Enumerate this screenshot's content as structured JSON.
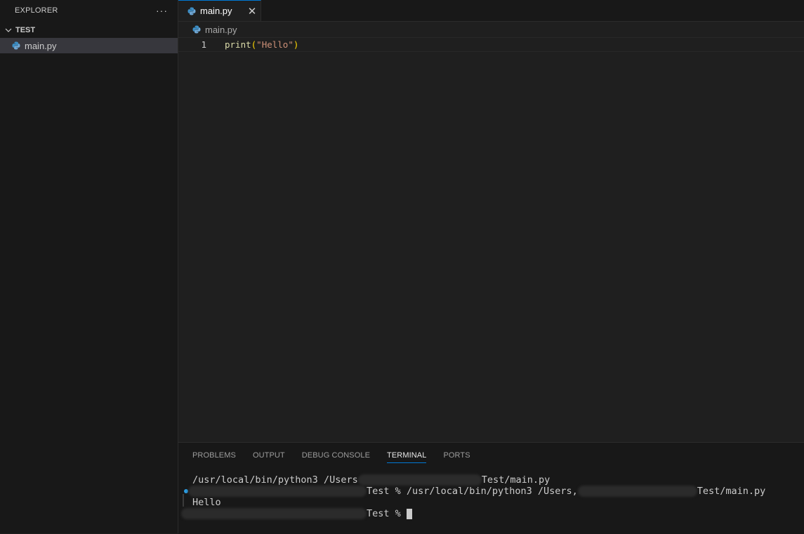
{
  "sidebar": {
    "title": "EXPLORER",
    "more": "···",
    "folder": "TEST",
    "files": [
      {
        "name": "main.py",
        "icon": "python-icon"
      }
    ]
  },
  "editor": {
    "tab": {
      "label": "main.py",
      "close": "✕"
    },
    "breadcrumb": "main.py",
    "lines": [
      {
        "num": "1",
        "fn": "print",
        "open": "(",
        "str": "\"Hello\"",
        "close": ")"
      }
    ]
  },
  "panel": {
    "tabs": [
      "PROBLEMS",
      "OUTPUT",
      "DEBUG CONSOLE",
      "TERMINAL",
      "PORTS"
    ],
    "active_tab": "TERMINAL",
    "terminal": {
      "line1_prefix": "/usr/local/bin/python3 /Users",
      "line1_suffix": "Test/main.py",
      "line2_prompt": "Test % ",
      "line2_cmd": "/usr/local/bin/python3 /Users,",
      "line2_suffix": "Test/main.py",
      "output": "Hello",
      "line4_prompt": "Test % "
    }
  },
  "colors": {
    "accent": "#0078d4",
    "string": "#ce9178",
    "function": "#dcdcaa",
    "bracket": "#ffd700"
  }
}
